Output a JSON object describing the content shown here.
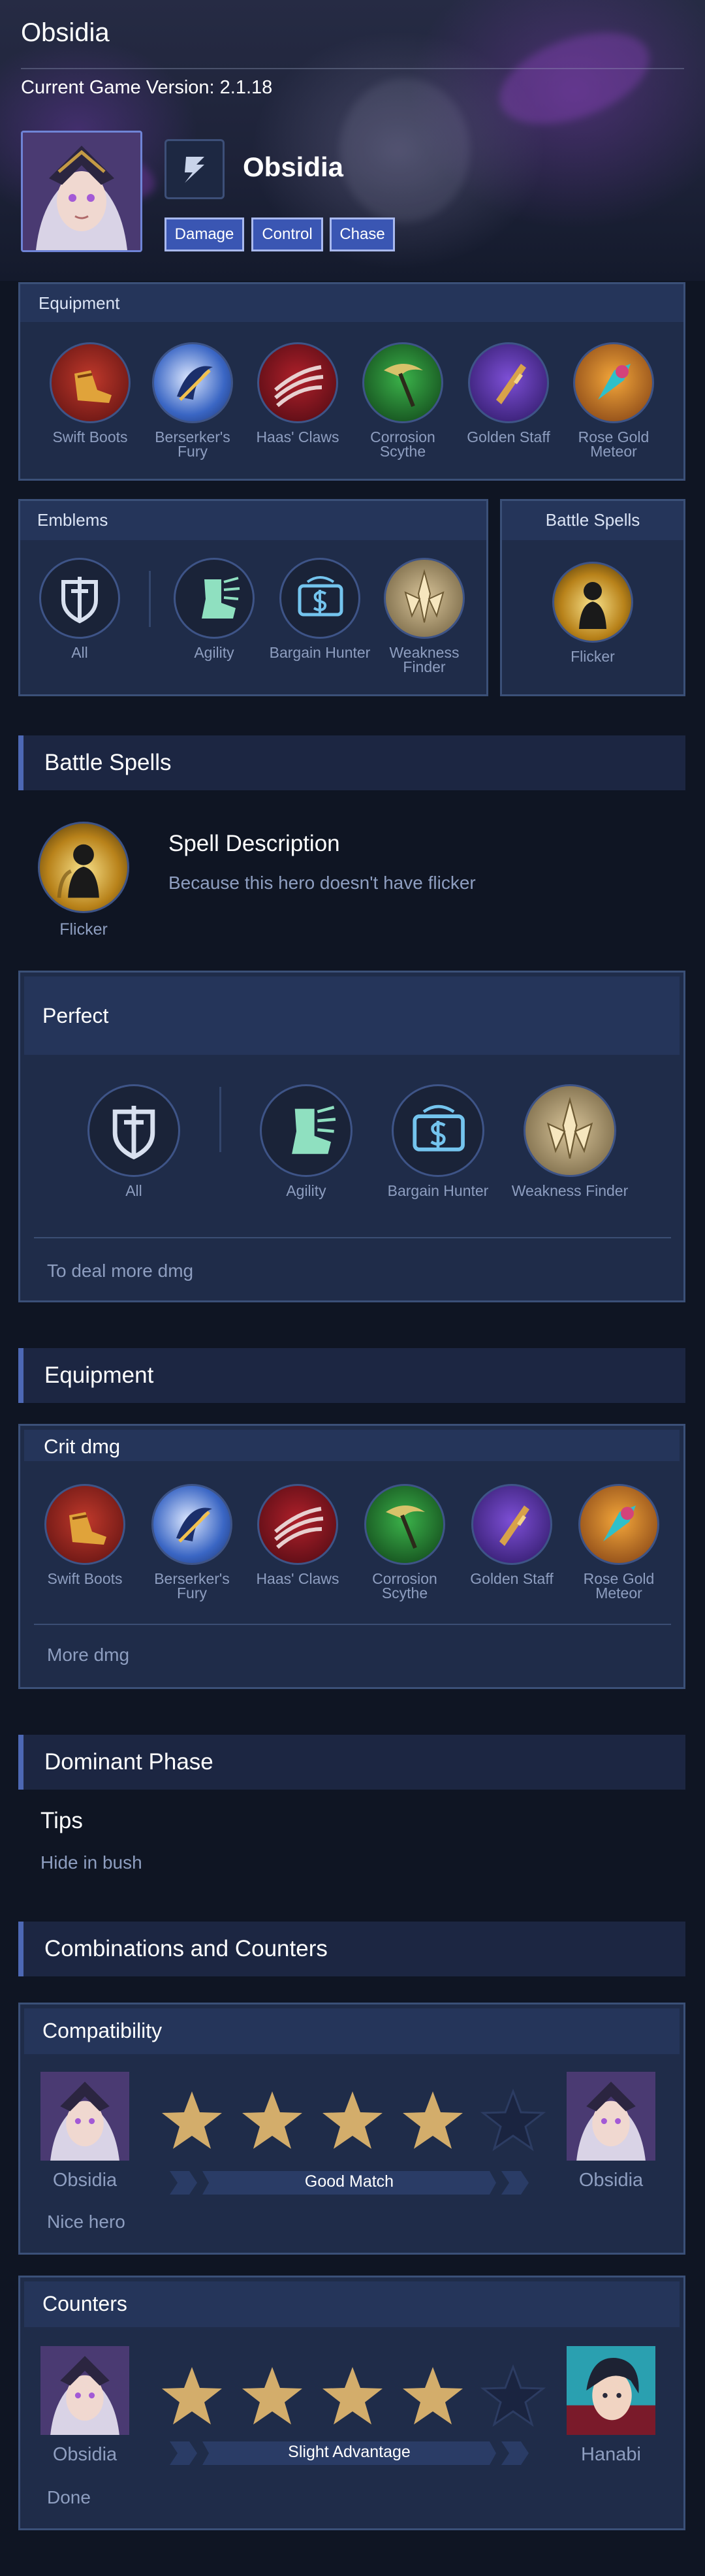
{
  "header": {
    "title": "Obsidia",
    "version": "Current Game Version: 2.1.18",
    "hero_name": "Obsidia",
    "tags": [
      "Damage",
      "Control",
      "Chase"
    ]
  },
  "equipment_panel": {
    "title": "Equipment",
    "items": [
      "Swift Boots",
      "Berserker's Fury",
      "Haas' Claws",
      "Corrosion Scythe",
      "Golden Staff",
      "Rose Gold Meteor"
    ]
  },
  "emblems_panel": {
    "title": "Emblems",
    "items": [
      "All",
      "Agility",
      "Bargain Hunter",
      "Weakness Finder"
    ]
  },
  "battle_spells_panel": {
    "title": "Battle Spells",
    "spell": "Flicker"
  },
  "battle_spells_section": {
    "title": "Battle Spells",
    "spell_label": "Flicker",
    "desc_title": "Spell Description",
    "desc_text": "Because this hero doesn't have flicker"
  },
  "perfect_panel": {
    "title": "Perfect",
    "items": [
      "All",
      "Agility",
      "Bargain Hunter",
      "Weakness Finder"
    ],
    "note": "To deal more dmg"
  },
  "equipment_section": {
    "title": "Equipment",
    "build_title": "Crit dmg",
    "items": [
      "Swift Boots",
      "Berserker's Fury",
      "Haas' Claws",
      "Corrosion Scythe",
      "Golden Staff",
      "Rose Gold Meteor"
    ],
    "note": "More dmg"
  },
  "dominant_phase": {
    "title": "Dominant Phase",
    "tips_title": "Tips",
    "tips_text": "Hide in bush"
  },
  "combinations": {
    "title": "Combinations and Counters",
    "compatibility": {
      "title": "Compatibility",
      "left_hero": "Obsidia",
      "right_hero": "Obsidia",
      "rating": 4,
      "max_rating": 5,
      "verdict": "Good Match",
      "note": "Nice hero"
    },
    "counters": {
      "title": "Counters",
      "left_hero": "Obsidia",
      "right_hero": "Hanabi",
      "rating": 4,
      "max_rating": 5,
      "verdict": "Slight Advantage",
      "note": "Done"
    }
  },
  "colors": {
    "background": "#0f1523",
    "panel": "#1f2c49",
    "accent": "#4d68b4",
    "tag": "#3a56b3",
    "star_gold": "#d3ad6b",
    "muted_text": "#8e9ec0"
  }
}
